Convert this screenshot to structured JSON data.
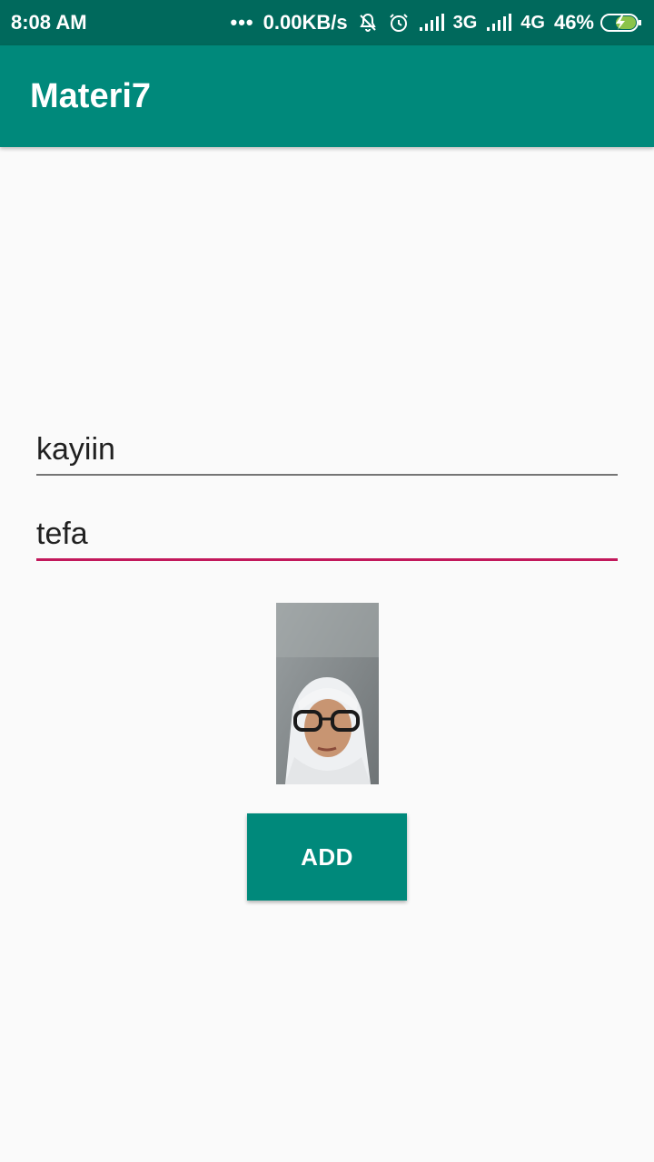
{
  "status_bar": {
    "time": "8:08 AM",
    "more": "•••",
    "net_speed": "0.00KB/s",
    "bell_icon": "bell-off-icon",
    "alarm_icon": "alarm-icon",
    "signal1_label": "3G",
    "signal2_label": "4G",
    "battery_percent": "46%"
  },
  "app_bar": {
    "title": "Materi7"
  },
  "form": {
    "name_value": "kayiin",
    "class_value": "tefa",
    "add_label": "ADD"
  },
  "colors": {
    "status_bar": "#00695c",
    "primary": "#00897b",
    "accent": "#c2185b",
    "background": "#fafafa"
  }
}
